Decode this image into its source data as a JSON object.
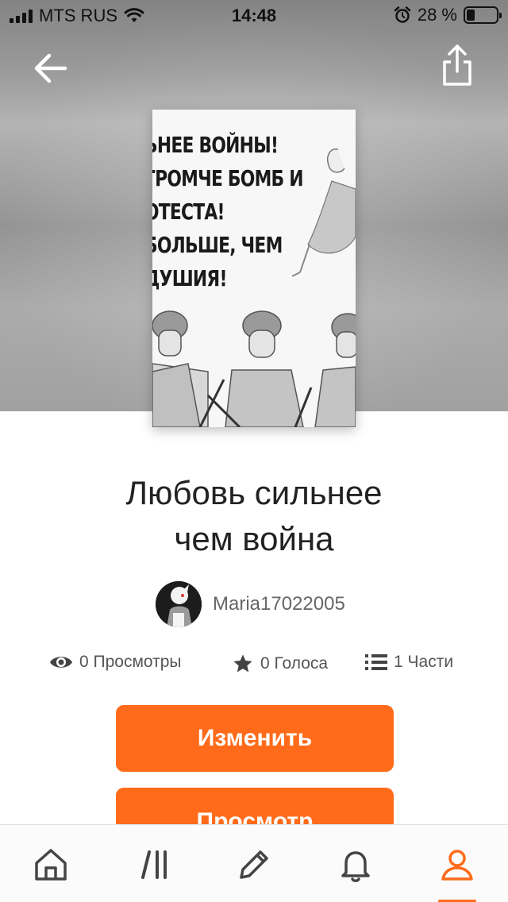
{
  "status_bar": {
    "carrier": "MTS RUS",
    "time": "14:48",
    "battery_percent": "28 %",
    "battery_level": 0.28
  },
  "cover": {
    "text_lines": [
      "ЬНЕЕ ВОЙНЫ!",
      "ГРОМЧЕ БОМБ И",
      "ОТЕСТА!",
      "БОЛЬШЕ, ЧЕМ",
      "ДУШИЯ!"
    ]
  },
  "story": {
    "title_line1": "Любовь сильнее",
    "title_line2": "чем война",
    "author": "Maria17022005"
  },
  "stats": {
    "views": "0",
    "views_label": "Просмотры",
    "votes": "0",
    "votes_label": "Голоса",
    "parts": "1",
    "parts_label": "Части"
  },
  "actions": {
    "edit_label": "Изменить",
    "view_label": "Просмотр"
  },
  "tabbar": {
    "items": [
      "home-icon",
      "library-icon",
      "write-icon",
      "notifications-icon",
      "profile-icon"
    ],
    "active": "profile-icon"
  },
  "colors": {
    "accent": "#ff6b1a",
    "text": "#222222",
    "muted": "#666666"
  }
}
